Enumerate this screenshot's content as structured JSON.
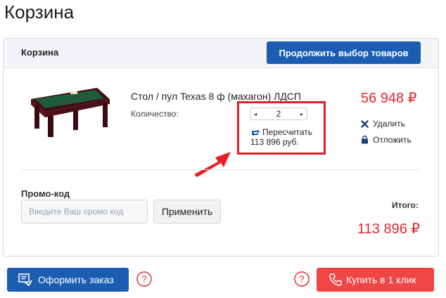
{
  "page": {
    "title": "Корзина"
  },
  "cart": {
    "header_label": "Корзина",
    "continue_button": "Продолжить выбор товаров",
    "item": {
      "name": "Стол / пул Texas 8 ф (махагон) ЛДСП",
      "qty_label": "Количество:",
      "qty_value": "2",
      "price": "56 948 ₽",
      "recalc_label": "Пересчитать",
      "line_total": "113 896 руб.",
      "delete_label": "Удалить",
      "postpone_label": "Отложить"
    },
    "promo": {
      "label": "Промо-код",
      "placeholder": "Введите Ваш промо код",
      "apply_button": "Применить"
    },
    "total": {
      "label": "Итого:",
      "value": "113 896 ₽"
    }
  },
  "footer": {
    "order_button": "Оформить заказ",
    "oneclick_button": "Купить в 1 клик"
  },
  "colors": {
    "primary_blue": "#1b5db0",
    "price_red": "#e0262b",
    "oneclick_red": "#f04545",
    "highlight_red": "#d8232a"
  },
  "icons": {
    "qty_decrease": "triangle-left-icon",
    "qty_increase": "triangle-right-icon",
    "recalc": "refresh-icon",
    "delete": "close-icon",
    "postpone": "lock-icon",
    "order": "checkout-icon",
    "help": "question-icon",
    "oneclick": "phone-icon"
  }
}
